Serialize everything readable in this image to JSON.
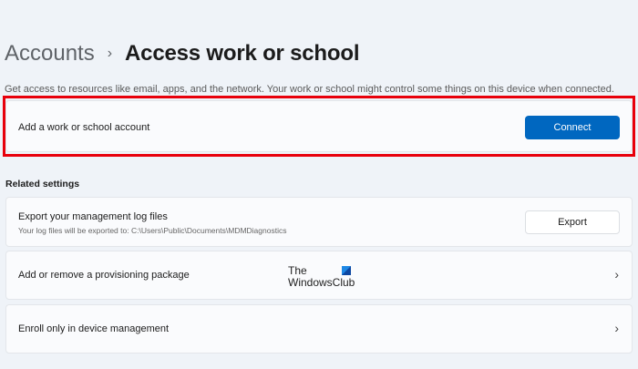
{
  "breadcrumb": {
    "parent": "Accounts",
    "separator": "›",
    "current": "Access work or school"
  },
  "description": "Get access to resources like email, apps, and the network. Your work or school might control some things on this device when connected.",
  "add_account": {
    "label": "Add a work or school account",
    "button": "Connect"
  },
  "related": {
    "heading": "Related settings",
    "export": {
      "label": "Export your management log files",
      "sub": "Your log files will be exported to: C:\\Users\\Public\\Documents\\MDMDiagnostics",
      "button": "Export"
    },
    "provisioning": {
      "label": "Add or remove a provisioning package",
      "chevron": "›"
    },
    "enroll": {
      "label": "Enroll only in device management",
      "chevron": "›"
    }
  },
  "watermark": {
    "line1": "The",
    "line2": "WindowsClub"
  },
  "colors": {
    "accent": "#0067c0",
    "highlight": "#e8000b"
  }
}
